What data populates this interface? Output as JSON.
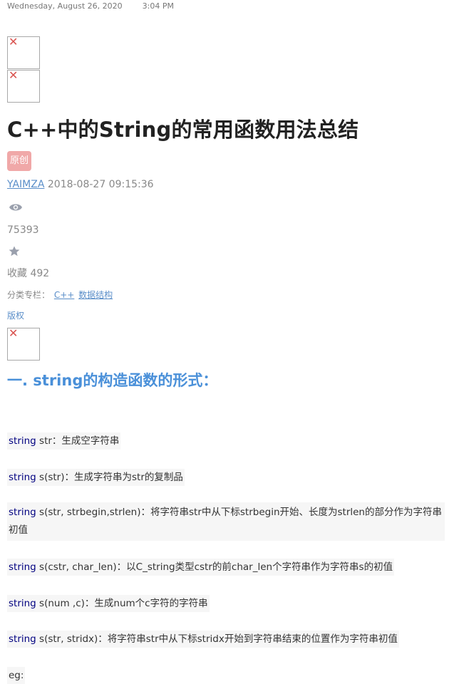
{
  "timestamp": {
    "date": "Wednesday, August 26, 2020",
    "time": "3:04 PM"
  },
  "article": {
    "title": "C++中的String的常用函数用法总结",
    "badge": "原创",
    "author": "YAIMZA",
    "datetime": "2018-08-27 09:15:36",
    "views": "75393",
    "favorites_label": "收藏 492",
    "category_label": "分类专栏：",
    "categories": [
      "C++",
      "数据结构"
    ],
    "copyright": "版权"
  },
  "section": {
    "heading": "一. string的构造函数的形式：",
    "lines": [
      {
        "kw": "string",
        "text": " str：生成空字符串"
      },
      {
        "kw": "string",
        "text": " s(str)：生成字符串为str的复制品"
      },
      {
        "kw": "string",
        "text": " s(str, strbegin,strlen)：将字符串str中从下标strbegin开始、长度为strlen的部分作为字符串初值"
      },
      {
        "kw": "string",
        "text": " s(cstr, char_len)：以C_string类型cstr的前char_len个字符串作为字符串s的初值"
      },
      {
        "kw": "string",
        "text": " s(num ,c)：生成num个c字符的字符串"
      },
      {
        "kw": "string",
        "text": " s(str, stridx)：将字符串str中从下标stridx开始到字符串结束的位置作为字符串初值"
      }
    ],
    "eg": "eg:"
  },
  "icons": [
    "broken-image-icon",
    "eye-icon",
    "star-icon"
  ]
}
